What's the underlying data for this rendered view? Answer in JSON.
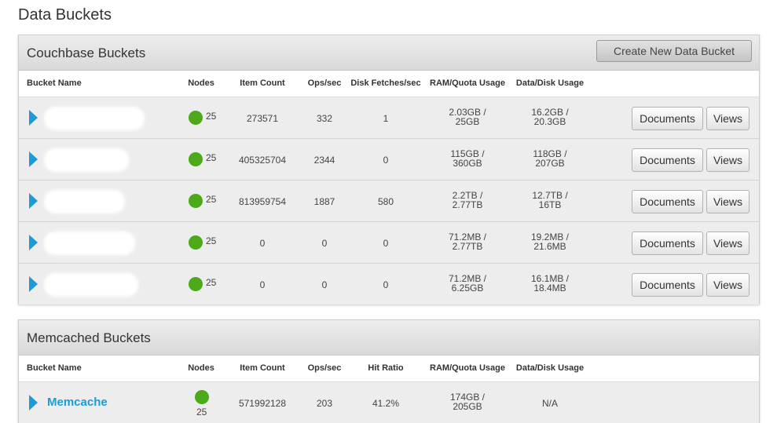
{
  "page": {
    "title": "Data Buckets"
  },
  "couchbase": {
    "title": "Couchbase Buckets",
    "create_label": "Create New Data Bucket",
    "headers": {
      "name": "Bucket Name",
      "nodes": "Nodes",
      "items": "Item Count",
      "ops": "Ops/sec",
      "fetches": "Disk Fetches/sec",
      "ram": "RAM/Quota Usage",
      "disk": "Data/Disk Usage"
    },
    "rows": [
      {
        "nodes": "25",
        "items": "273571",
        "ops": "332",
        "fetches": "1",
        "ram1": "2.03GB /",
        "ram2": "25GB",
        "disk1": "16.2GB /",
        "disk2": "20.3GB",
        "docs": "Documents",
        "views": "Views"
      },
      {
        "nodes": "25",
        "items": "405325704",
        "ops": "2344",
        "fetches": "0",
        "ram1": "115GB /",
        "ram2": "360GB",
        "disk1": "118GB /",
        "disk2": "207GB",
        "docs": "Documents",
        "views": "Views"
      },
      {
        "nodes": "25",
        "items": "813959754",
        "ops": "1887",
        "fetches": "580",
        "ram1": "2.2TB /",
        "ram2": "2.77TB",
        "disk1": "12.7TB /",
        "disk2": "16TB",
        "docs": "Documents",
        "views": "Views"
      },
      {
        "nodes": "25",
        "items": "0",
        "ops": "0",
        "fetches": "0",
        "ram1": "71.2MB /",
        "ram2": "2.77TB",
        "disk1": "19.2MB /",
        "disk2": "21.6MB",
        "docs": "Documents",
        "views": "Views"
      },
      {
        "nodes": "25",
        "items": "0",
        "ops": "0",
        "fetches": "0",
        "ram1": "71.2MB /",
        "ram2": "6.25GB",
        "disk1": "16.1MB /",
        "disk2": "18.4MB",
        "docs": "Documents",
        "views": "Views"
      }
    ]
  },
  "memcached": {
    "title": "Memcached Buckets",
    "headers": {
      "name": "Bucket Name",
      "nodes": "Nodes",
      "items": "Item Count",
      "ops": "Ops/sec",
      "hit": "Hit Ratio",
      "ram": "RAM/Quota Usage",
      "disk": "Data/Disk Usage"
    },
    "rows": [
      {
        "name": "Memcache",
        "nodes": "25",
        "items": "571992128",
        "ops": "203",
        "hit": "41.2%",
        "ram1": "174GB /",
        "ram2": "205GB",
        "disk": "N/A"
      }
    ]
  },
  "colors": {
    "accent": "#1e9bd7",
    "status_ok": "#4caa1a"
  },
  "icons": {
    "expand": "triangle-right-icon",
    "status": "status-healthy-icon"
  }
}
